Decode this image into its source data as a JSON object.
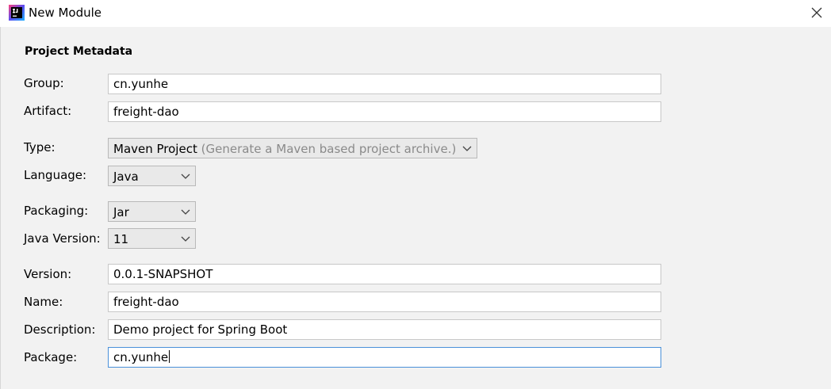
{
  "window": {
    "title": "New Module"
  },
  "section": {
    "title": "Project Metadata"
  },
  "fields": {
    "group": {
      "label": "Group:",
      "value": "cn.yunhe"
    },
    "artifact": {
      "label": "Artifact:",
      "value": "freight-dao"
    },
    "type": {
      "label": "Type:",
      "value": "Maven Project",
      "hint": "(Generate a Maven based project archive.)"
    },
    "language": {
      "label": "Language:",
      "value": "Java"
    },
    "packaging": {
      "label": "Packaging:",
      "value": "Jar"
    },
    "java_version": {
      "label": "Java Version:",
      "value": "11"
    },
    "version": {
      "label": "Version:",
      "value": "0.0.1-SNAPSHOT"
    },
    "name": {
      "label": "Name:",
      "value": "freight-dao"
    },
    "description": {
      "label": "Description:",
      "value": "Demo project for Spring Boot"
    },
    "package": {
      "label": "Package:",
      "value": "cn.yunhe"
    }
  },
  "icons": {
    "app": "intellij-idea-icon",
    "close": "close-icon",
    "dropdown": "chevron-down-icon"
  },
  "colors": {
    "focus_border": "#4a90d9",
    "hint_text": "#8a8a8a"
  }
}
